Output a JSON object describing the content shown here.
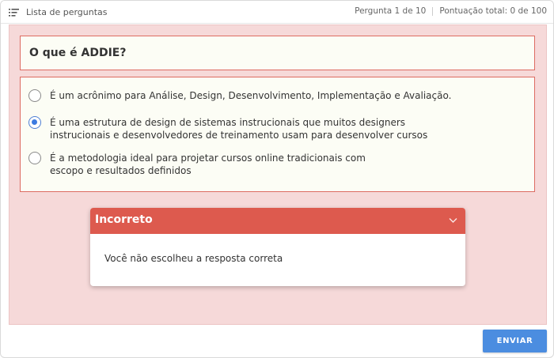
{
  "topbar": {
    "list_label": "Lista de perguntas",
    "question_progress": "Pergunta 1 de 10",
    "score": "Pontuação total: 0 de 100"
  },
  "question": {
    "text": "O que é ADDIE?"
  },
  "answers": [
    {
      "line1": "É um acrônimo para Análise, Design, Desenvolvimento, Implementação e Avaliação.",
      "line2": "",
      "selected": false
    },
    {
      "line1": "É uma estrutura de design de sistemas instrucionais que muitos designers",
      "line2": "instrucionais e desenvolvedores de treinamento usam para desenvolver cursos",
      "selected": true
    },
    {
      "line1": "É a metodologia ideal para projetar cursos online tradicionais com",
      "line2": "escopo e resultados definidos",
      "selected": false
    }
  ],
  "feedback": {
    "title": "Incorreto",
    "message": "Você não escolheu a resposta correta"
  },
  "submit_label": "ENVIAR",
  "colors": {
    "background_incorrect": "#f6d9d9",
    "border_incorrect": "#dd6b61",
    "feedback_header": "#dd5a4e",
    "accent": "#4b8de0"
  },
  "icons": {
    "list": "list-icon",
    "radio": "radio-icon",
    "chevron": "chevron-down-icon"
  }
}
